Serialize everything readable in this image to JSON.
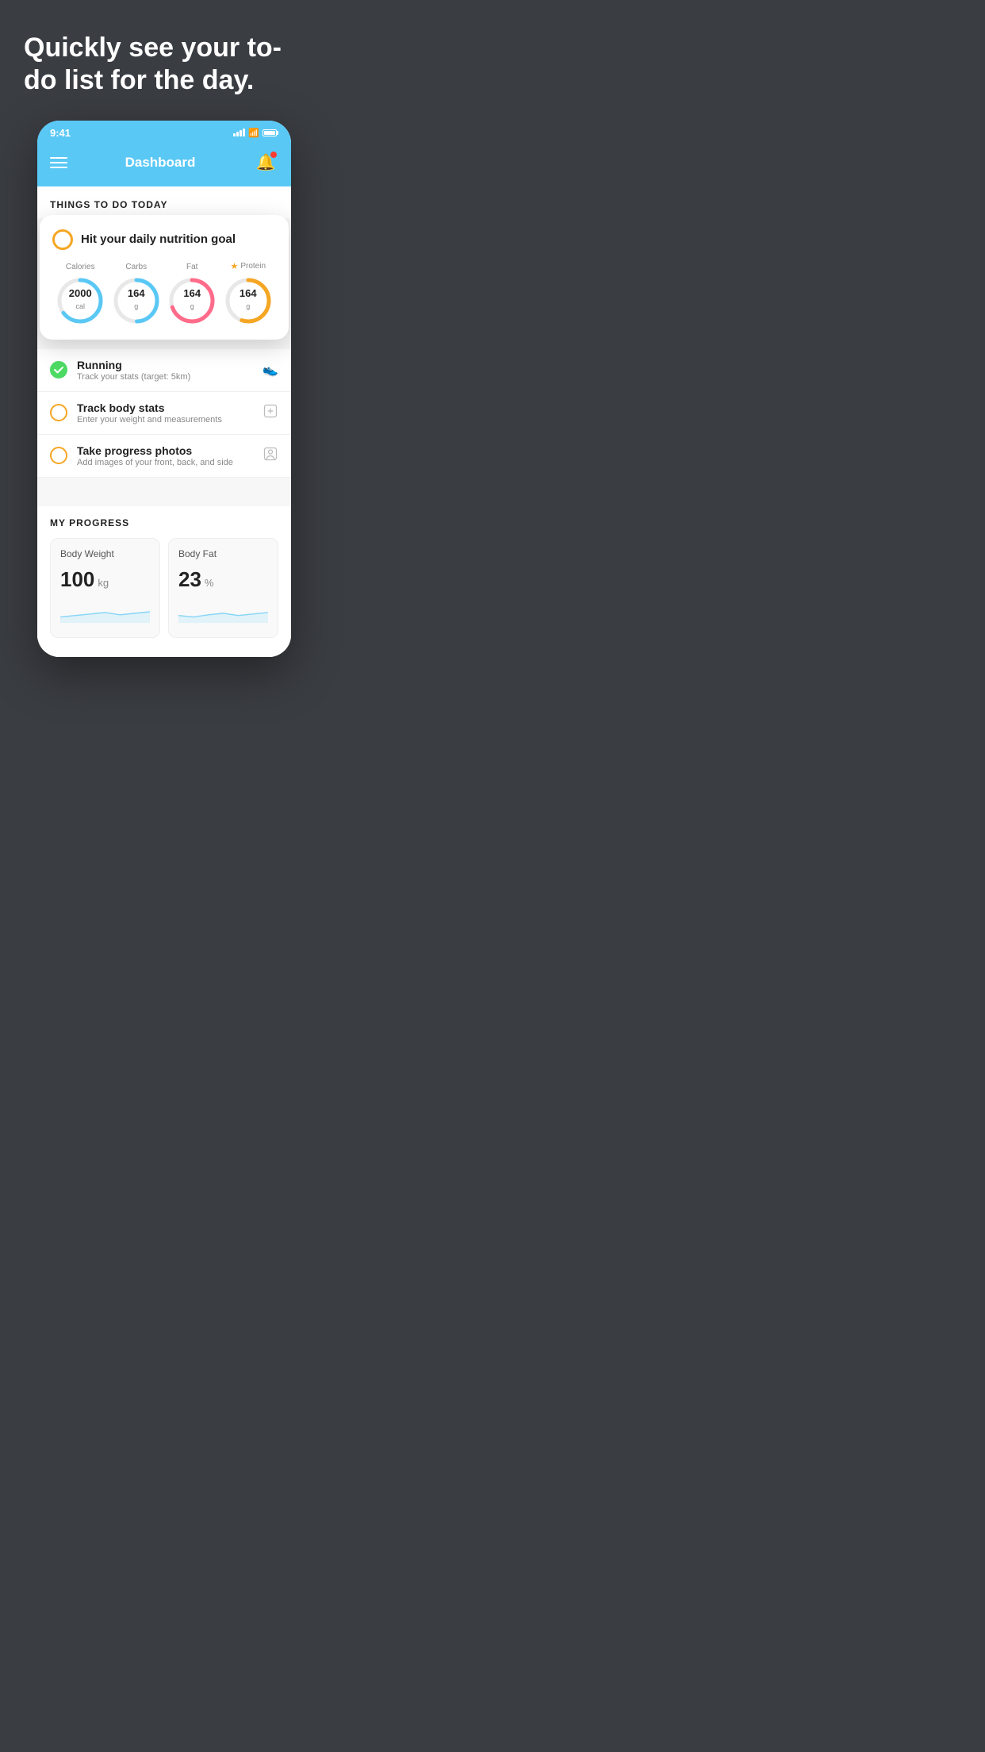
{
  "background": {
    "color": "#3a3d42"
  },
  "hero": {
    "title": "Quickly see your to-do list for the day."
  },
  "phone": {
    "statusBar": {
      "time": "9:41"
    },
    "header": {
      "title": "Dashboard"
    },
    "sectionTitle": "THINGS TO DO TODAY",
    "floatingCard": {
      "checkIcon": "circle",
      "title": "Hit your daily nutrition goal",
      "nutrients": [
        {
          "label": "Calories",
          "value": "2000",
          "unit": "cal",
          "color": "#5ac8f5",
          "percent": 65,
          "starred": false
        },
        {
          "label": "Carbs",
          "value": "164",
          "unit": "g",
          "color": "#5ac8f5",
          "percent": 50,
          "starred": false
        },
        {
          "label": "Fat",
          "value": "164",
          "unit": "g",
          "color": "#ff6b8a",
          "percent": 70,
          "starred": false
        },
        {
          "label": "Protein",
          "value": "164",
          "unit": "g",
          "color": "#f5a623",
          "percent": 55,
          "starred": true
        }
      ]
    },
    "todoItems": [
      {
        "id": "running",
        "circleColor": "green",
        "title": "Running",
        "subtitle": "Track your stats (target: 5km)",
        "icon": "shoe"
      },
      {
        "id": "body-stats",
        "circleColor": "yellow",
        "title": "Track body stats",
        "subtitle": "Enter your weight and measurements",
        "icon": "scale"
      },
      {
        "id": "progress-photos",
        "circleColor": "yellow",
        "title": "Take progress photos",
        "subtitle": "Add images of your front, back, and side",
        "icon": "person"
      }
    ],
    "progressSection": {
      "title": "MY PROGRESS",
      "cards": [
        {
          "id": "body-weight",
          "title": "Body Weight",
          "value": "100",
          "unit": "kg"
        },
        {
          "id": "body-fat",
          "title": "Body Fat",
          "value": "23",
          "unit": "%"
        }
      ]
    }
  }
}
